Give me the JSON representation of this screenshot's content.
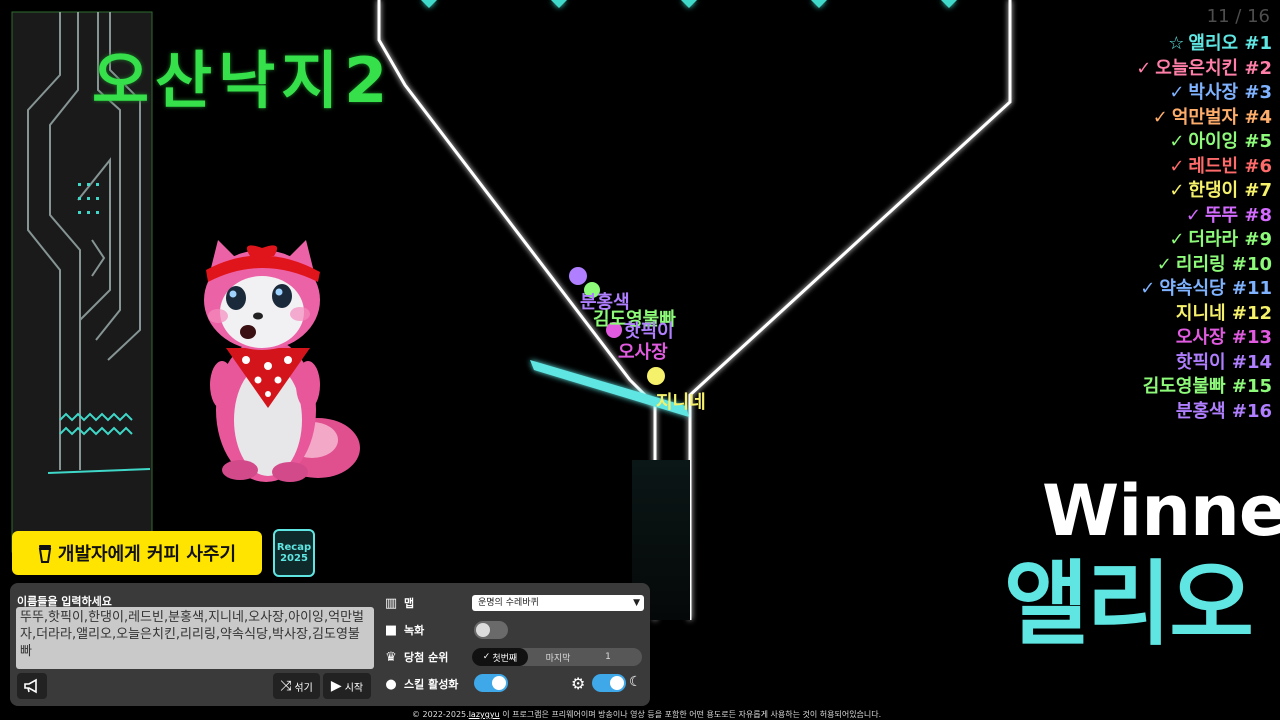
{
  "map_title": "오산낙지2",
  "progress": "11 / 16",
  "rankings": [
    {
      "mark": "☆",
      "name": "앨리오",
      "rank": "#1",
      "color": "#5fe6e3"
    },
    {
      "mark": "✓",
      "name": "오늘은치킨",
      "rank": "#2",
      "color": "#ff7fa8"
    },
    {
      "mark": "✓",
      "name": "박사장",
      "rank": "#3",
      "color": "#7fb2ff"
    },
    {
      "mark": "✓",
      "name": "억만벌자",
      "rank": "#4",
      "color": "#ffad6b"
    },
    {
      "mark": "✓",
      "name": "아이잉",
      "rank": "#5",
      "color": "#8dfa7a"
    },
    {
      "mark": "✓",
      "name": "레드빈",
      "rank": "#6",
      "color": "#ff6a6a"
    },
    {
      "mark": "✓",
      "name": "한댕이",
      "rank": "#7",
      "color": "#f6f16b"
    },
    {
      "mark": "✓",
      "name": "뚜뚜",
      "rank": "#8",
      "color": "#d46bff"
    },
    {
      "mark": "✓",
      "name": "더라라",
      "rank": "#9",
      "color": "#8dfa7a"
    },
    {
      "mark": "✓",
      "name": "리리링",
      "rank": "#10",
      "color": "#8dfa7a"
    },
    {
      "mark": "✓",
      "name": "약속식당",
      "rank": "#11",
      "color": "#7fb2ff"
    },
    {
      "mark": "",
      "name": "지니네",
      "rank": "#12",
      "color": "#f6f16b"
    },
    {
      "mark": "",
      "name": "오사장",
      "rank": "#13",
      "color": "#e05be0"
    },
    {
      "mark": "",
      "name": "핫픽이",
      "rank": "#14",
      "color": "#b07fff"
    },
    {
      "mark": "",
      "name": "김도영불빠",
      "rank": "#15",
      "color": "#8dfa7a"
    },
    {
      "mark": "",
      "name": "분홍색",
      "rank": "#16",
      "color": "#b07fff"
    }
  ],
  "marble_labels": [
    {
      "name": "분홍색",
      "color": "#b07fff"
    },
    {
      "name": "김도영불빠",
      "color": "#8dfa7a"
    },
    {
      "name": "핫픽이",
      "color": "#b07fff"
    },
    {
      "name": "오사장",
      "color": "#e05be0"
    },
    {
      "name": "지니네",
      "color": "#f6f16b"
    }
  ],
  "winner": {
    "label": "Winner",
    "name": "앨리오"
  },
  "coffee_button": "개발자에게 커피 사주기",
  "recap_button": {
    "line1": "Recap",
    "line2": "2025"
  },
  "names_label": "이름들을 입력하세요",
  "names_value": "뚜뚜,핫픽이,한댕이,레드빈,분홍색,지니네,오사장,아이잉,억만벌자,더라라,앨리오,오늘은치킨,리리링,약속식당,박사장,김도영불빠",
  "shuffle_label": "섞기",
  "start_label": "시작",
  "options": {
    "map_label": "맵",
    "map_value": "운명의 수레바퀴",
    "record_label": "녹화",
    "record_on": false,
    "rank_label": "당첨 순위",
    "rank_first": "첫번째",
    "rank_last": "마지막",
    "rank_number": "1",
    "skill_label": "스킬 활성화",
    "skill_on": true,
    "dark_mode_on": true
  },
  "footer": {
    "prefix": "© 2022-2025.",
    "link": "lazygyu",
    "suffix": " 이 프로그램은 프리웨어이며 방송이나 영상 등을 포함한 어떤 용도로든 자유롭게 사용하는 것이 허용되어있습니다."
  },
  "colors": {
    "accent": "#5fe6e3",
    "title": "#35e04b",
    "coffee": "#ffe400"
  }
}
